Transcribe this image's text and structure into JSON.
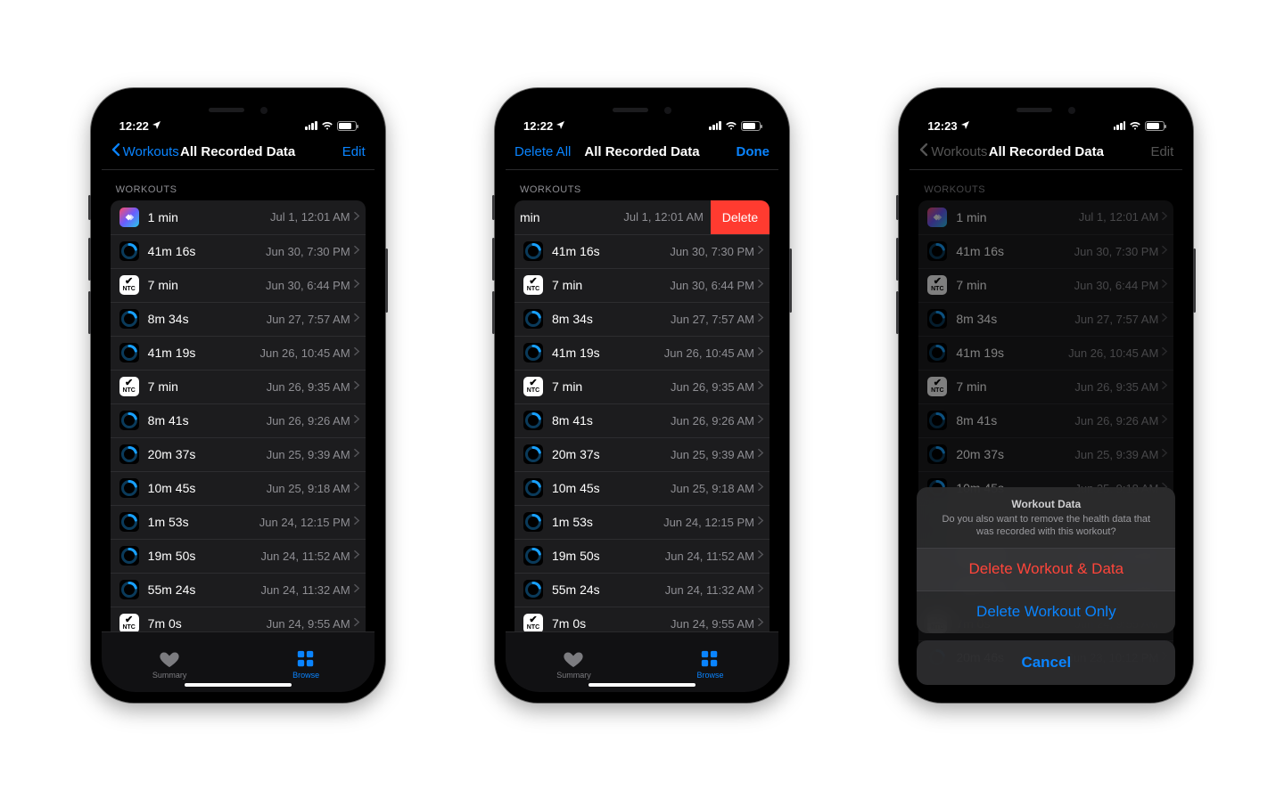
{
  "phones": {
    "a": {
      "time": "12:22",
      "nav": {
        "back_label": "Workouts",
        "title": "All Recorded Data",
        "right_label": "Edit"
      },
      "tabs": {
        "summary": "Summary",
        "browse": "Browse"
      }
    },
    "b": {
      "time": "12:22",
      "nav": {
        "left_label": "Delete All",
        "title": "All Recorded Data",
        "right_label": "Done"
      },
      "swipe": {
        "delete_label": "Delete",
        "partial_duration": "min"
      },
      "tabs": {
        "summary": "Summary",
        "browse": "Browse"
      }
    },
    "c": {
      "time": "12:23",
      "nav": {
        "back_label": "Workouts",
        "title": "All Recorded Data",
        "right_label": "Edit"
      },
      "sheet": {
        "title": "Workout Data",
        "message": "Do you also want to remove the health data that was recorded with this workout?",
        "delete_data": "Delete Workout & Data",
        "delete_only": "Delete Workout Only",
        "cancel": "Cancel"
      }
    }
  },
  "section_header": "WORKOUTS",
  "workouts": [
    {
      "app": "shortcuts",
      "duration": "1 min",
      "timestamp": "Jul 1, 12:01 AM"
    },
    {
      "app": "ring",
      "duration": "41m 16s",
      "timestamp": "Jun 30, 7:30 PM"
    },
    {
      "app": "ntc",
      "duration": "7 min",
      "timestamp": "Jun 30, 6:44 PM"
    },
    {
      "app": "ring",
      "duration": "8m 34s",
      "timestamp": "Jun 27, 7:57 AM"
    },
    {
      "app": "ring",
      "duration": "41m 19s",
      "timestamp": "Jun 26, 10:45 AM"
    },
    {
      "app": "ntc",
      "duration": "7 min",
      "timestamp": "Jun 26, 9:35 AM"
    },
    {
      "app": "ring",
      "duration": "8m 41s",
      "timestamp": "Jun 26, 9:26 AM"
    },
    {
      "app": "ring",
      "duration": "20m 37s",
      "timestamp": "Jun 25, 9:39 AM"
    },
    {
      "app": "ring",
      "duration": "10m 45s",
      "timestamp": "Jun 25, 9:18 AM"
    },
    {
      "app": "ring",
      "duration": "1m 53s",
      "timestamp": "Jun 24, 12:15 PM"
    },
    {
      "app": "ring",
      "duration": "19m 50s",
      "timestamp": "Jun 24, 11:52 AM"
    },
    {
      "app": "ring",
      "duration": "55m 24s",
      "timestamp": "Jun 24, 11:32 AM"
    },
    {
      "app": "ntc",
      "duration": "7m 0s",
      "timestamp": "Jun 24, 9:55 AM"
    },
    {
      "app": "ring",
      "duration": "20m 46s",
      "timestamp": "Jun 23, 10:12 PM"
    }
  ]
}
